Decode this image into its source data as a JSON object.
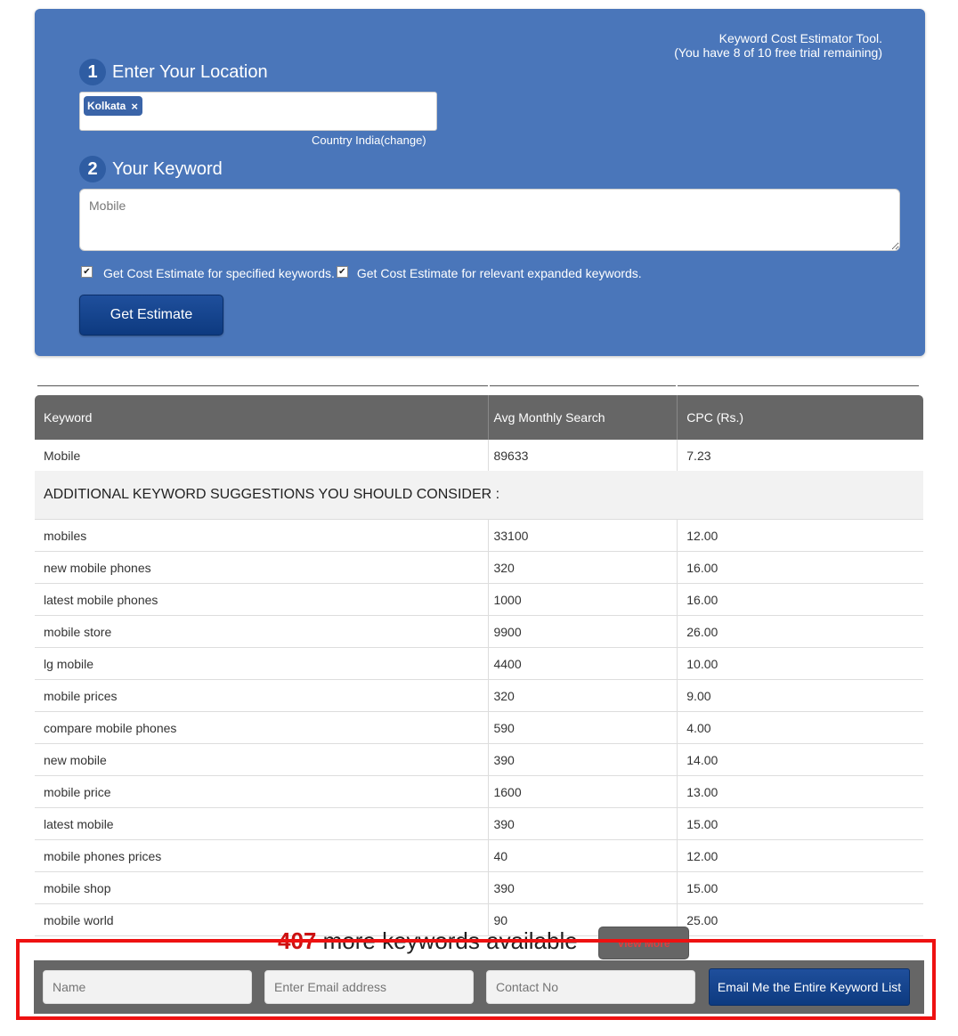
{
  "tool": {
    "title": "Keyword Cost Estimator Tool.",
    "trial": "(You have 8 of 10 free trial remaining)"
  },
  "location": {
    "step_number": "1",
    "label": "Enter Your Location",
    "tag": "Kolkata",
    "tag_remove": "×",
    "country_prefix": "Country India",
    "country_change": "(change)"
  },
  "keyword": {
    "step_number": "2",
    "label": "Your Keyword",
    "value": "Mobile"
  },
  "options": {
    "specified": "Get Cost Estimate for specified keywords.",
    "expanded": "Get Cost Estimate for relevant expanded keywords.",
    "check_glyph": "✔"
  },
  "estimate_button": "Get Estimate",
  "table": {
    "headers": [
      "Keyword",
      "Avg Monthly Search",
      "CPC (Rs.)"
    ],
    "main_row": [
      "Mobile",
      "89633",
      "7.23"
    ],
    "suggestions_heading": "ADDITIONAL KEYWORD SUGGESTIONS YOU SHOULD CONSIDER :",
    "rows": [
      [
        "mobiles",
        "33100",
        "12.00"
      ],
      [
        "new mobile phones",
        "320",
        "16.00"
      ],
      [
        "latest mobile phones",
        "1000",
        "16.00"
      ],
      [
        "mobile store",
        "9900",
        "26.00"
      ],
      [
        "lg mobile",
        "4400",
        "10.00"
      ],
      [
        "mobile prices",
        "320",
        "9.00"
      ],
      [
        "compare mobile phones",
        "590",
        "4.00"
      ],
      [
        "new mobile",
        "390",
        "14.00"
      ],
      [
        "mobile price",
        "1600",
        "13.00"
      ],
      [
        "latest mobile",
        "390",
        "15.00"
      ],
      [
        "mobile phones prices",
        "40",
        "12.00"
      ],
      [
        "mobile shop",
        "390",
        "15.00"
      ],
      [
        "mobile world",
        "90",
        "25.00"
      ]
    ]
  },
  "more": {
    "count": "407",
    "text": " more keywords available",
    "view_more": "View More"
  },
  "email_form": {
    "name_placeholder": "Name",
    "email_placeholder": "Enter Email address",
    "contact_placeholder": "Contact No",
    "submit": "Email Me the Entire Keyword List"
  },
  "colors": {
    "panel": "#4a76ba",
    "button": "#0d3a80",
    "table_header": "#666666",
    "highlight": "#ee1111"
  }
}
